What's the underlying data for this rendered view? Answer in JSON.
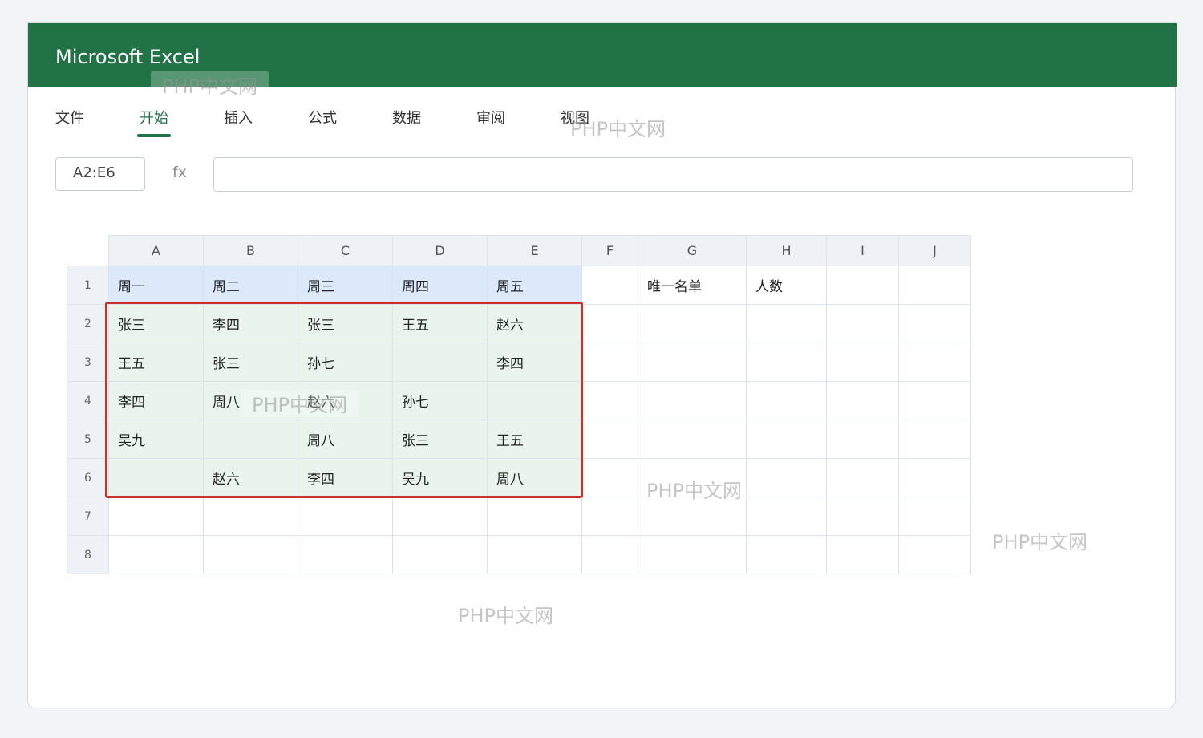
{
  "app": {
    "title": "Microsoft Excel"
  },
  "ribbon": {
    "tabs": [
      {
        "label": "文件",
        "active": false
      },
      {
        "label": "开始",
        "active": true
      },
      {
        "label": "插入",
        "active": false
      },
      {
        "label": "公式",
        "active": false
      },
      {
        "label": "数据",
        "active": false
      },
      {
        "label": "审阅",
        "active": false
      },
      {
        "label": "视图",
        "active": false
      }
    ]
  },
  "formula_bar": {
    "name_box": "A2:E6",
    "fx_label": "fx",
    "formula": ""
  },
  "sheet": {
    "columns": [
      "A",
      "B",
      "C",
      "D",
      "E",
      "F",
      "G",
      "H",
      "I",
      "J"
    ],
    "rows": [
      {
        "num": "1",
        "cells": [
          "周一",
          "周二",
          "周三",
          "周四",
          "周五",
          "",
          "唯一名单",
          "人数",
          "",
          ""
        ]
      },
      {
        "num": "2",
        "cells": [
          "张三",
          "李四",
          "张三",
          "王五",
          "赵六",
          "",
          "",
          "",
          "",
          ""
        ]
      },
      {
        "num": "3",
        "cells": [
          "王五",
          "张三",
          "孙七",
          "",
          "李四",
          "",
          "",
          "",
          "",
          ""
        ]
      },
      {
        "num": "4",
        "cells": [
          "李四",
          "周八",
          "赵六",
          "孙七",
          "",
          "",
          "",
          "",
          "",
          ""
        ]
      },
      {
        "num": "5",
        "cells": [
          "吴九",
          "",
          "周八",
          "张三",
          "王五",
          "",
          "",
          "",
          "",
          ""
        ]
      },
      {
        "num": "6",
        "cells": [
          "",
          "赵六",
          "李四",
          "吴九",
          "周八",
          "",
          "",
          "",
          "",
          ""
        ]
      },
      {
        "num": "7",
        "cells": [
          "",
          "",
          "",
          "",
          "",
          "",
          "",
          "",
          "",
          ""
        ]
      },
      {
        "num": "8",
        "cells": [
          "",
          "",
          "",
          "",
          "",
          "",
          "",
          "",
          "",
          ""
        ]
      }
    ],
    "selection_range": "A2:E6",
    "selection_color": "#c9302c",
    "header_fill": "#dce9fb",
    "selection_fill": "#e9f5ec"
  },
  "watermarks": [
    "PHP中文网",
    "PHP中文网",
    "PHP中文网",
    "PHP中文网",
    "PHP中文网",
    "PHP中文网"
  ],
  "theme": {
    "accent": "#217346"
  }
}
